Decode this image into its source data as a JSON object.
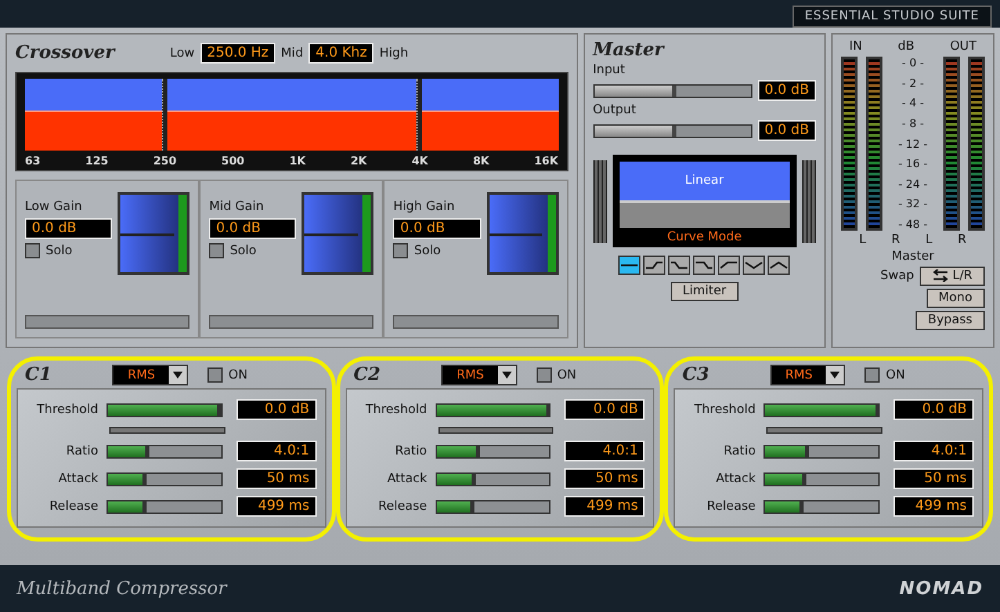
{
  "header": {
    "suite": "ESSENTIAL STUDIO SUITE"
  },
  "crossover": {
    "title": "Crossover",
    "low_label": "Low",
    "low_value": "250.0 Hz",
    "mid_label": "Mid",
    "mid_value": "4.0 Khz",
    "high_label": "High",
    "scale": [
      "63",
      "125",
      "250",
      "500",
      "1K",
      "2K",
      "4K",
      "8K",
      "16K"
    ],
    "bands": [
      {
        "label": "Low Gain",
        "value": "0.0 dB",
        "solo_label": "Solo",
        "solo": false,
        "level": 0.5
      },
      {
        "label": "Mid Gain",
        "value": "0.0 dB",
        "solo_label": "Solo",
        "solo": false,
        "level": 0.5
      },
      {
        "label": "High Gain",
        "value": "0.0 dB",
        "solo_label": "Solo",
        "solo": false,
        "level": 0.5
      }
    ]
  },
  "master": {
    "title": "Master",
    "input": {
      "label": "Input",
      "level": 0.5,
      "value": "0.0 dB"
    },
    "output": {
      "label": "Output",
      "level": 0.5,
      "value": "0.0 dB"
    },
    "curve_mode": "Linear",
    "curve_caption": "Curve Mode",
    "curve_buttons": [
      {
        "kind": "flat",
        "selected": true
      },
      {
        "kind": "rise",
        "selected": false
      },
      {
        "kind": "fall-step",
        "selected": false
      },
      {
        "kind": "fall",
        "selected": false
      },
      {
        "kind": "ramp",
        "selected": false
      },
      {
        "kind": "dip",
        "selected": false
      },
      {
        "kind": "bump",
        "selected": false
      }
    ],
    "limiter": "Limiter"
  },
  "meters": {
    "in_label": "IN",
    "db_label": "dB",
    "out_label": "OUT",
    "scale": [
      "- 0 -",
      "- 2 -",
      "- 4 -",
      "- 8 -",
      "- 12 -",
      "- 16 -",
      "- 24 -",
      "- 32 -",
      "- 48 -"
    ],
    "channels": [
      "L",
      "R",
      "L",
      "R"
    ],
    "caption": "Master",
    "swap_label": "Swap",
    "swap_button": "L/R",
    "mono": "Mono",
    "bypass": "Bypass"
  },
  "compressors": [
    {
      "name": "C1",
      "detector": "RMS",
      "on_label": "ON",
      "on": false,
      "params": [
        {
          "label": "Threshold",
          "level": 0.97,
          "value": "0.0 dB"
        },
        {
          "label": "Ratio",
          "level": 0.33,
          "value": "4.0:1"
        },
        {
          "label": "Attack",
          "level": 0.31,
          "value": "50 ms"
        },
        {
          "label": "Release",
          "level": 0.3,
          "value": "499 ms"
        }
      ]
    },
    {
      "name": "C2",
      "detector": "RMS",
      "on_label": "ON",
      "on": false,
      "params": [
        {
          "label": "Threshold",
          "level": 0.97,
          "value": "0.0 dB"
        },
        {
          "label": "Ratio",
          "level": 0.35,
          "value": "4.0:1"
        },
        {
          "label": "Attack",
          "level": 0.31,
          "value": "50 ms"
        },
        {
          "label": "Release",
          "level": 0.3,
          "value": "499 ms"
        }
      ]
    },
    {
      "name": "C3",
      "detector": "RMS",
      "on_label": "ON",
      "on": false,
      "params": [
        {
          "label": "Threshold",
          "level": 0.97,
          "value": "0.0 dB"
        },
        {
          "label": "Ratio",
          "level": 0.35,
          "value": "4.0:1"
        },
        {
          "label": "Attack",
          "level": 0.33,
          "value": "50 ms"
        },
        {
          "label": "Release",
          "level": 0.3,
          "value": "499 ms"
        }
      ]
    }
  ],
  "footer": {
    "title": "Multiband Compressor",
    "logo": "NOMAD"
  }
}
